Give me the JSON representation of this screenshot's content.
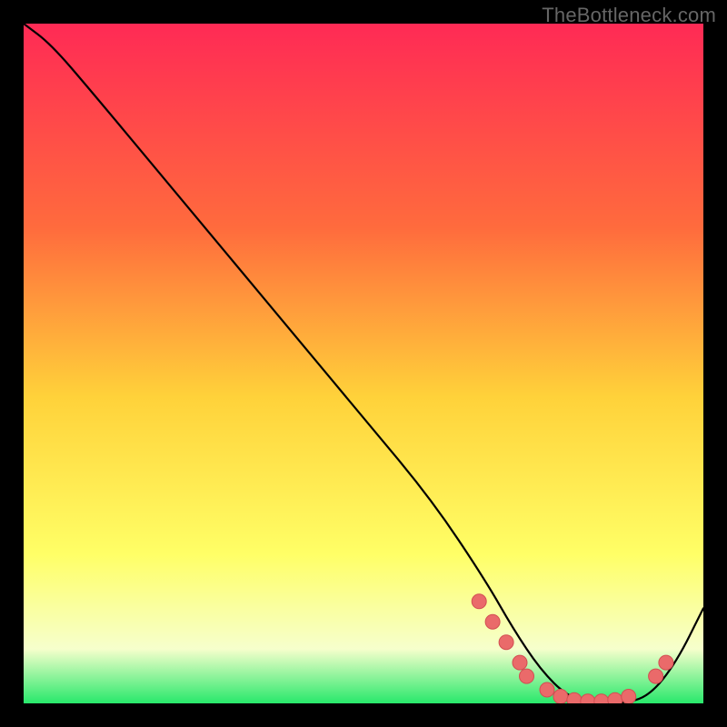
{
  "watermark": "TheBottleneck.com",
  "colors": {
    "gradient_top": "#ff2a55",
    "gradient_mid_high": "#ff6b3d",
    "gradient_mid": "#ffd23a",
    "gradient_low": "#ffff66",
    "gradient_pale": "#f6ffcc",
    "gradient_green": "#28e86b",
    "frame": "#000000",
    "curve": "#000000",
    "dot_fill": "#ea6a6a",
    "dot_stroke": "#d24e52"
  },
  "chart_data": {
    "type": "line",
    "title": "",
    "xlabel": "",
    "ylabel": "",
    "ylim": [
      0,
      100
    ],
    "xlim": [
      0,
      100
    ],
    "series": [
      {
        "name": "bottleneck-curve",
        "x": [
          0,
          4,
          10,
          20,
          30,
          40,
          50,
          60,
          68,
          72,
          76,
          80,
          84,
          88,
          92,
          96,
          100
        ],
        "y": [
          100,
          97,
          90,
          78,
          66,
          54,
          42,
          30,
          18,
          11,
          5,
          1,
          0,
          0,
          1,
          6,
          14
        ]
      }
    ],
    "dots": [
      {
        "x": 67,
        "y": 15
      },
      {
        "x": 69,
        "y": 12
      },
      {
        "x": 71,
        "y": 9
      },
      {
        "x": 73,
        "y": 6
      },
      {
        "x": 74,
        "y": 4
      },
      {
        "x": 77,
        "y": 2
      },
      {
        "x": 79,
        "y": 1
      },
      {
        "x": 81,
        "y": 0.5
      },
      {
        "x": 83,
        "y": 0.3
      },
      {
        "x": 85,
        "y": 0.3
      },
      {
        "x": 87,
        "y": 0.5
      },
      {
        "x": 89,
        "y": 1
      },
      {
        "x": 93,
        "y": 4
      },
      {
        "x": 94.5,
        "y": 6
      }
    ]
  }
}
